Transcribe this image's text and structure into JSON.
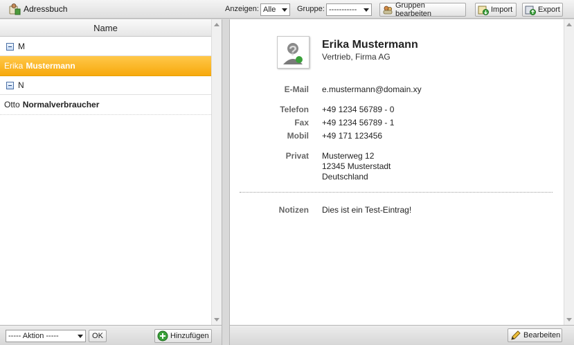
{
  "app": {
    "title": "Adressbuch"
  },
  "toolbar": {
    "show_label": "Anzeigen:",
    "show_value": "Alle",
    "group_label": "Gruppe:",
    "group_value": "-----------",
    "edit_groups_label": "Gruppen bearbeiten",
    "import_label": "Import",
    "export_label": "Export"
  },
  "list": {
    "header": "Name",
    "groups": [
      {
        "letter": "M",
        "contacts": [
          {
            "first": "Erika",
            "last": "Mustermann",
            "selected": true
          }
        ]
      },
      {
        "letter": "N",
        "contacts": [
          {
            "first": "Otto",
            "last": "Normalverbraucher",
            "selected": false
          }
        ]
      }
    ]
  },
  "left_footer": {
    "action_select": "----- Aktion -----",
    "ok_label": "OK",
    "add_label": "Hinzufügen"
  },
  "detail": {
    "name": "Erika Mustermann",
    "org": "Vertrieb, Firma AG",
    "email_label": "E-Mail",
    "email": "e.mustermann@domain.xy",
    "phone_label": "Telefon",
    "phone": "+49 1234 56789 - 0",
    "fax_label": "Fax",
    "fax": "+49 1234 56789 - 1",
    "mobile_label": "Mobil",
    "mobile": "+49 171 123456",
    "private_label": "Privat",
    "address": [
      "Musterweg 12",
      "12345 Musterstadt",
      "Deutschland"
    ],
    "notes_label": "Notizen",
    "notes": "Dies ist ein Test-Eintrag!"
  },
  "right_footer": {
    "edit_label": "Bearbeiten"
  },
  "colors": {
    "selection": "#f7a90c",
    "accent_green": "#3aa13a"
  }
}
